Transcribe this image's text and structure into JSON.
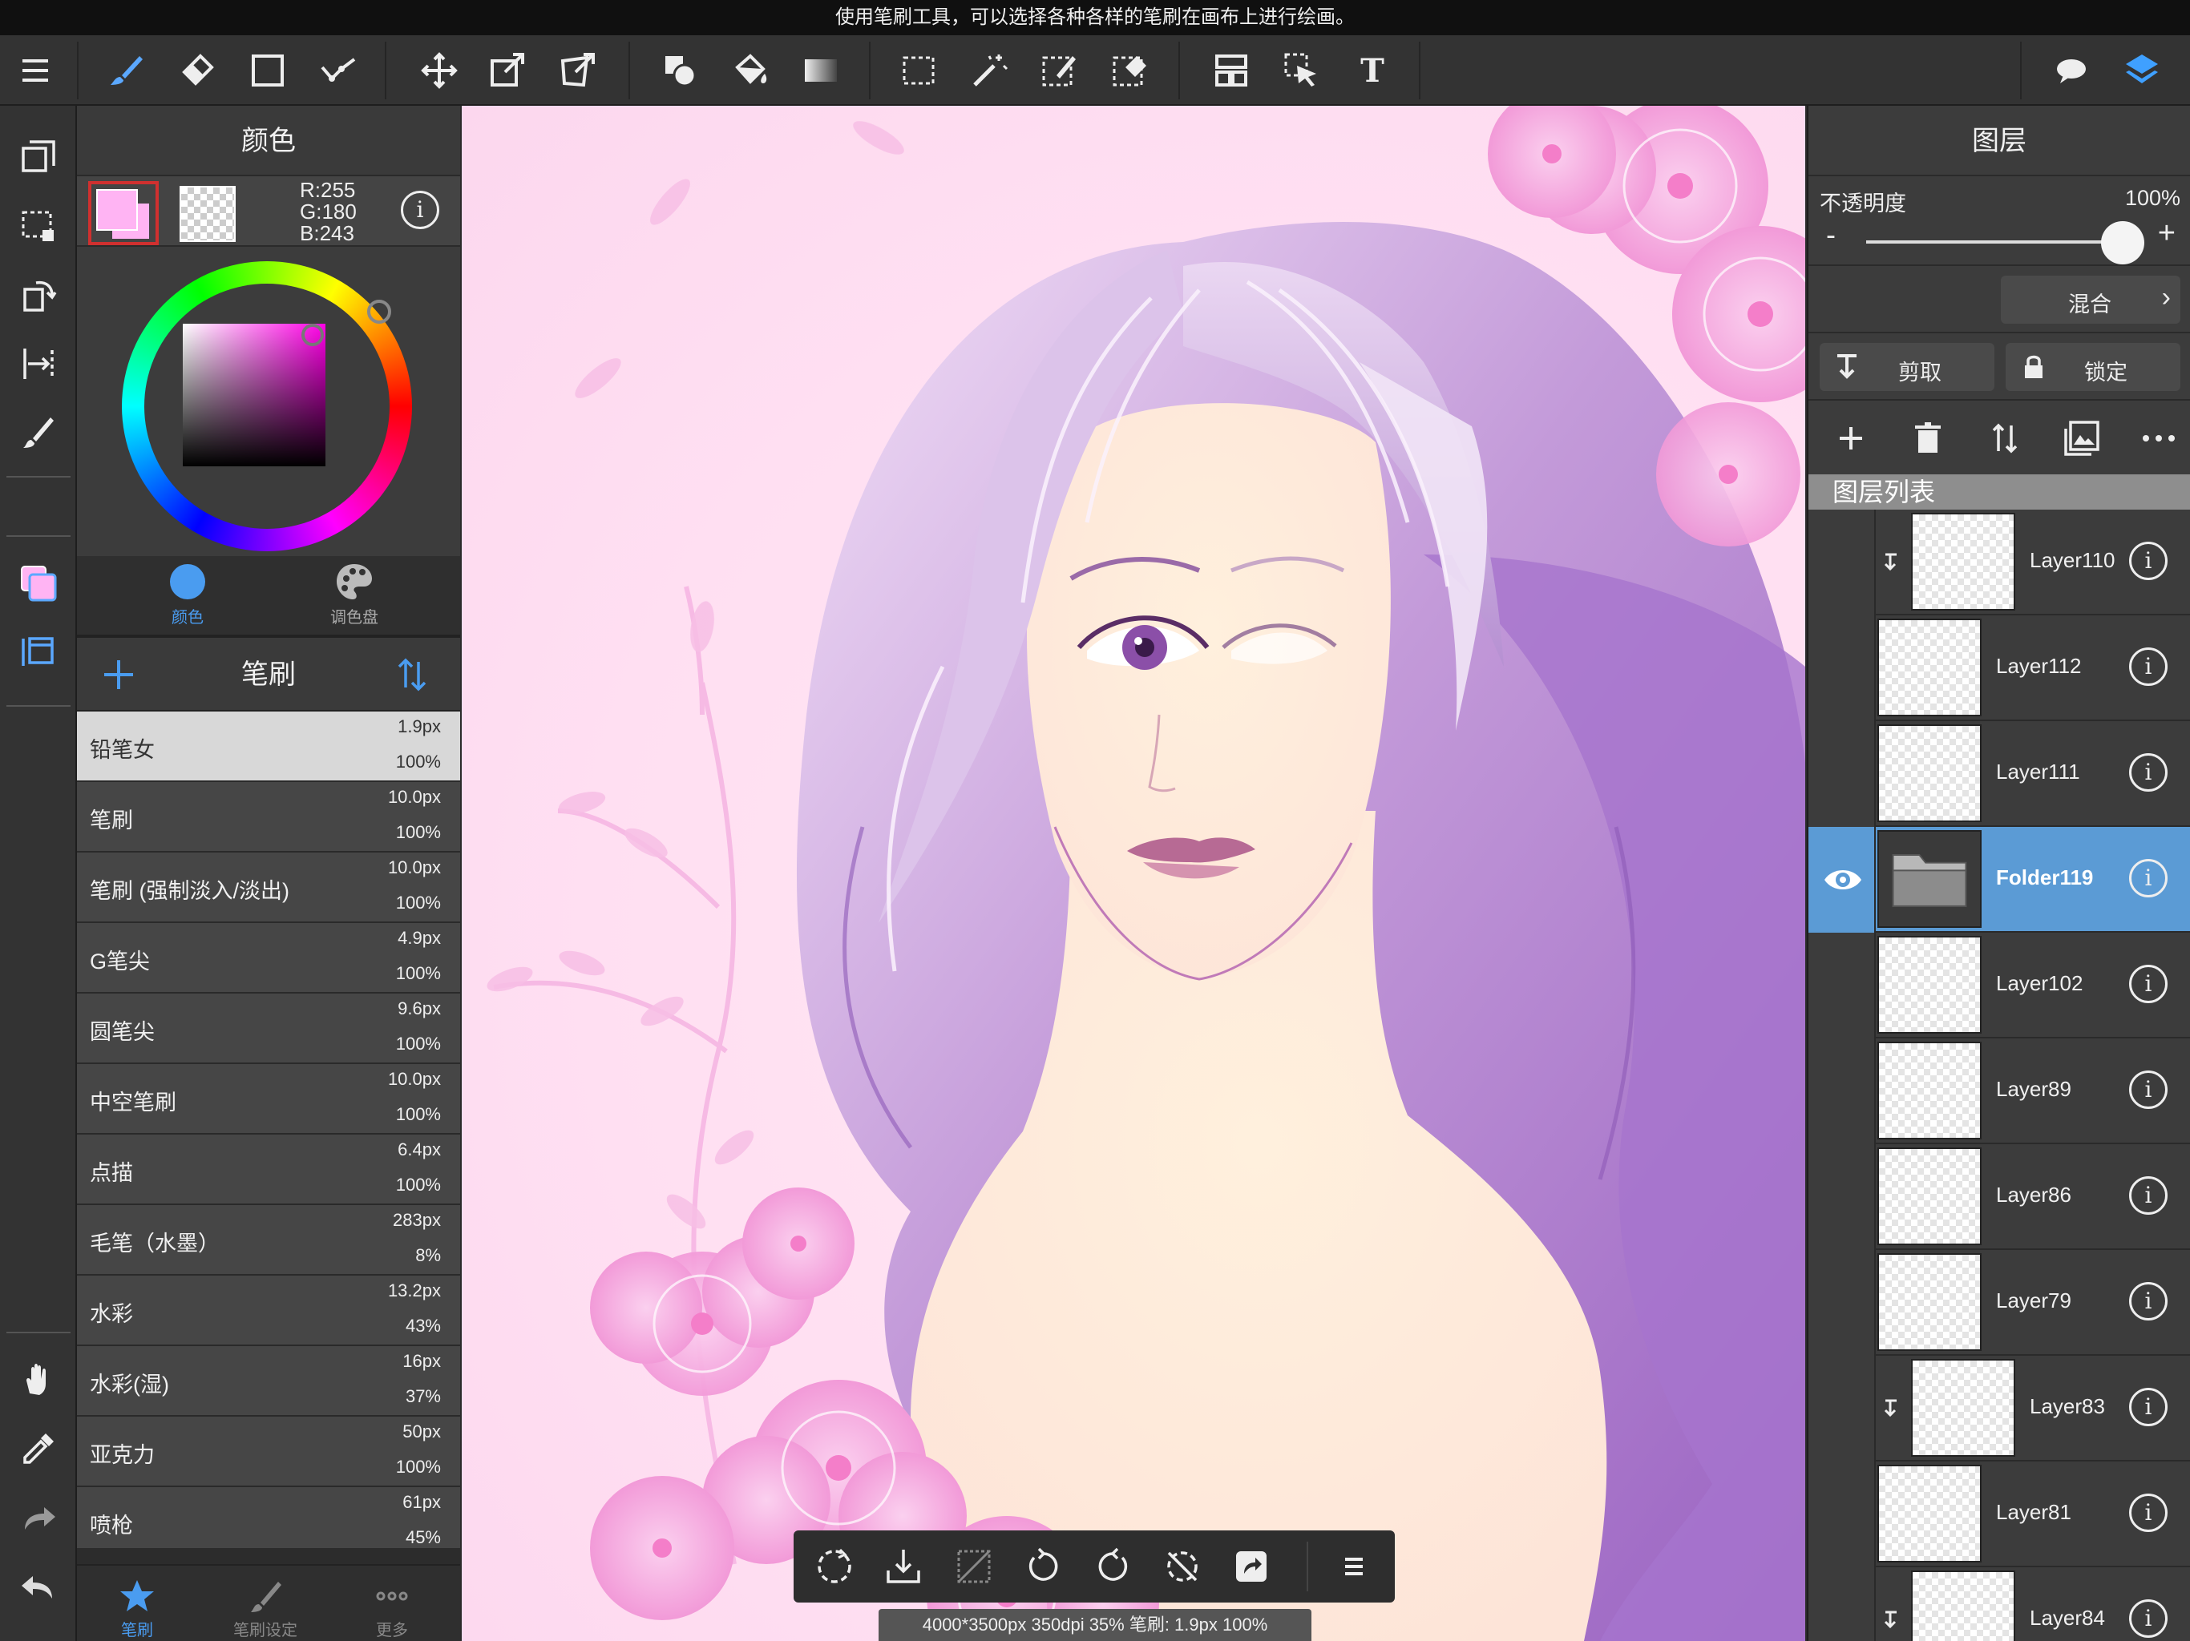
{
  "hint": "使用笔刷工具，可以选择各种各样的笔刷在画布上进行绘画。",
  "toolbar": {
    "left_icons": [
      "menu-icon"
    ],
    "tools": [
      "brush-icon",
      "eraser-icon",
      "rectangle-icon",
      "line-icon",
      "move-icon",
      "transform-icon",
      "distort-icon",
      "shape-fill-icon",
      "bucket-icon",
      "gradient-icon",
      "rect-select-icon",
      "magic-wand-icon",
      "select-pen-icon",
      "select-eraser-icon",
      "frame-icon",
      "operation-icon",
      "text-icon"
    ],
    "right_icons": [
      "speech-icon",
      "layers-icon"
    ]
  },
  "color_panel": {
    "title": "颜色",
    "rgb": {
      "r": "R:255",
      "g": "G:180",
      "b": "B:243"
    },
    "foreground": "#ffb4f3",
    "tabs": [
      {
        "label": "颜色",
        "icon": "color-circle-icon",
        "active": true
      },
      {
        "label": "调色盘",
        "icon": "palette-icon",
        "active": false
      }
    ]
  },
  "brush_panel": {
    "title": "笔刷",
    "brushes": [
      {
        "name": "铅笔女",
        "size": "1.9px",
        "opacity": "100%",
        "selected": true
      },
      {
        "name": "笔刷",
        "size": "10.0px",
        "opacity": "100%"
      },
      {
        "name": "笔刷 (强制淡入/淡出)",
        "size": "10.0px",
        "opacity": "100%"
      },
      {
        "name": "G笔尖",
        "size": "4.9px",
        "opacity": "100%"
      },
      {
        "name": "圆笔尖",
        "size": "9.6px",
        "opacity": "100%"
      },
      {
        "name": "中空笔刷",
        "size": "10.0px",
        "opacity": "100%"
      },
      {
        "name": "点描",
        "size": "6.4px",
        "opacity": "100%"
      },
      {
        "name": "毛笔（水墨）",
        "size": "283px",
        "opacity": "8%"
      },
      {
        "name": "水彩",
        "size": "13.2px",
        "opacity": "43%"
      },
      {
        "name": "水彩(湿)",
        "size": "16px",
        "opacity": "37%"
      },
      {
        "name": "亚克力",
        "size": "50px",
        "opacity": "100%"
      },
      {
        "name": "喷枪",
        "size": "61px",
        "opacity": "45%"
      }
    ],
    "tabs": [
      {
        "label": "笔刷",
        "active": true
      },
      {
        "label": "笔刷设定"
      },
      {
        "label": "更多"
      }
    ]
  },
  "status": "4000*3500px 350dpi 35% 笔刷: 1.9px 100%",
  "layer_panel": {
    "title": "图层",
    "opacity_label": "不透明度",
    "opacity_value": "100%",
    "opacity_fraction": 1.0,
    "blend_label": "混合",
    "clip_label": "剪取",
    "lock_label": "锁定",
    "list_title": "图层列表",
    "layers": [
      {
        "name": "Layer110",
        "clipped": true
      },
      {
        "name": "Layer112"
      },
      {
        "name": "Layer111"
      },
      {
        "name": "Folder119",
        "folder": true,
        "selected": true,
        "visible": true
      },
      {
        "name": "Layer102"
      },
      {
        "name": "Layer89"
      },
      {
        "name": "Layer86"
      },
      {
        "name": "Layer79"
      },
      {
        "name": "Layer83",
        "clipped": true
      },
      {
        "name": "Layer81"
      },
      {
        "name": "Layer84",
        "clipped": true
      }
    ]
  },
  "colors": {
    "accent": "#5b9bd5",
    "selection": "#d8d8d8",
    "panel": "#3c3c3c"
  }
}
